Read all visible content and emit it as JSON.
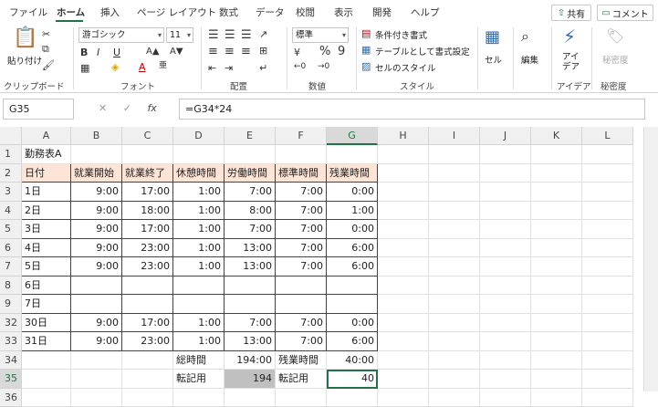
{
  "ribbon_tabs": [
    "ファイル",
    "ホーム",
    "挿入",
    "ページ レイアウト",
    "数式",
    "データ",
    "校閲",
    "表示",
    "開発",
    "ヘルプ"
  ],
  "share_label": "共有",
  "comment_label": "コメント",
  "clipboard": {
    "paste": "貼り付け",
    "label": "クリップボード"
  },
  "font": {
    "name": "游ゴシック",
    "size": "11",
    "label": "フォント",
    "bold": "B",
    "italic": "I",
    "underline": "U"
  },
  "alignment": {
    "label": "配置"
  },
  "number": {
    "format": "標準",
    "label": "数値",
    "percent": "%",
    "comma": "9"
  },
  "styles": {
    "conditional": "条件付き書式",
    "table": "テーブルとして書式設定",
    "cell_style": "セルのスタイル",
    "label": "スタイル"
  },
  "cells": {
    "cell": "セル"
  },
  "editing": {
    "edit": "編集"
  },
  "ideas": {
    "ideas": "アイ\nデア",
    "label": "アイデア"
  },
  "sensitivity": {
    "sens": "秘密度",
    "label": "秘密度"
  },
  "formula_bar": {
    "namebox": "G35",
    "formula": "=G34*24",
    "cancel": "✕",
    "enter": "✓",
    "fx": "fx"
  },
  "columns": [
    "A",
    "B",
    "C",
    "D",
    "E",
    "F",
    "G",
    "H",
    "I",
    "J",
    "K",
    "L"
  ],
  "selected_column": "G",
  "selected_row": "35",
  "rows": [
    {
      "num": "1",
      "cells": [
        "勤務表A",
        "",
        "",
        "",
        "",
        "",
        ""
      ]
    },
    {
      "num": "2",
      "cells": [
        "日付",
        "就業開始",
        "就業終了",
        "休憩時間",
        "労働時間",
        "標準時間",
        "残業時間"
      ],
      "header": true
    },
    {
      "num": "3",
      "cells": [
        "1日",
        "9:00",
        "17:00",
        "1:00",
        "7:00",
        "7:00",
        "0:00"
      ]
    },
    {
      "num": "4",
      "cells": [
        "2日",
        "9:00",
        "18:00",
        "1:00",
        "8:00",
        "7:00",
        "1:00"
      ]
    },
    {
      "num": "5",
      "cells": [
        "3日",
        "9:00",
        "17:00",
        "1:00",
        "7:00",
        "7:00",
        "0:00"
      ]
    },
    {
      "num": "6",
      "cells": [
        "4日",
        "9:00",
        "23:00",
        "1:00",
        "13:00",
        "7:00",
        "6:00"
      ]
    },
    {
      "num": "7",
      "cells": [
        "5日",
        "9:00",
        "23:00",
        "1:00",
        "13:00",
        "7:00",
        "6:00"
      ]
    },
    {
      "num": "8",
      "cells": [
        "6日",
        "",
        "",
        "",
        "",
        "",
        ""
      ]
    },
    {
      "num": "9",
      "cells": [
        "7日",
        "",
        "",
        "",
        "",
        "",
        ""
      ]
    },
    {
      "num": "32",
      "cells": [
        "30日",
        "9:00",
        "17:00",
        "1:00",
        "7:00",
        "7:00",
        "0:00"
      ]
    },
    {
      "num": "33",
      "cells": [
        "31日",
        "9:00",
        "23:00",
        "1:00",
        "13:00",
        "7:00",
        "6:00"
      ]
    },
    {
      "num": "34",
      "cells": [
        "",
        "",
        "",
        "総時間",
        "194:00",
        "残業時間",
        "40:00"
      ]
    },
    {
      "num": "35",
      "cells": [
        "",
        "",
        "",
        "転記用",
        "194",
        "転記用",
        "40"
      ]
    },
    {
      "num": "36",
      "cells": [
        "",
        "",
        "",
        "",
        "",
        "",
        ""
      ]
    }
  ],
  "colors": {
    "accent": "#217346",
    "header_fill": "#fce4d6",
    "selected_fill": "#c0c0c0"
  }
}
